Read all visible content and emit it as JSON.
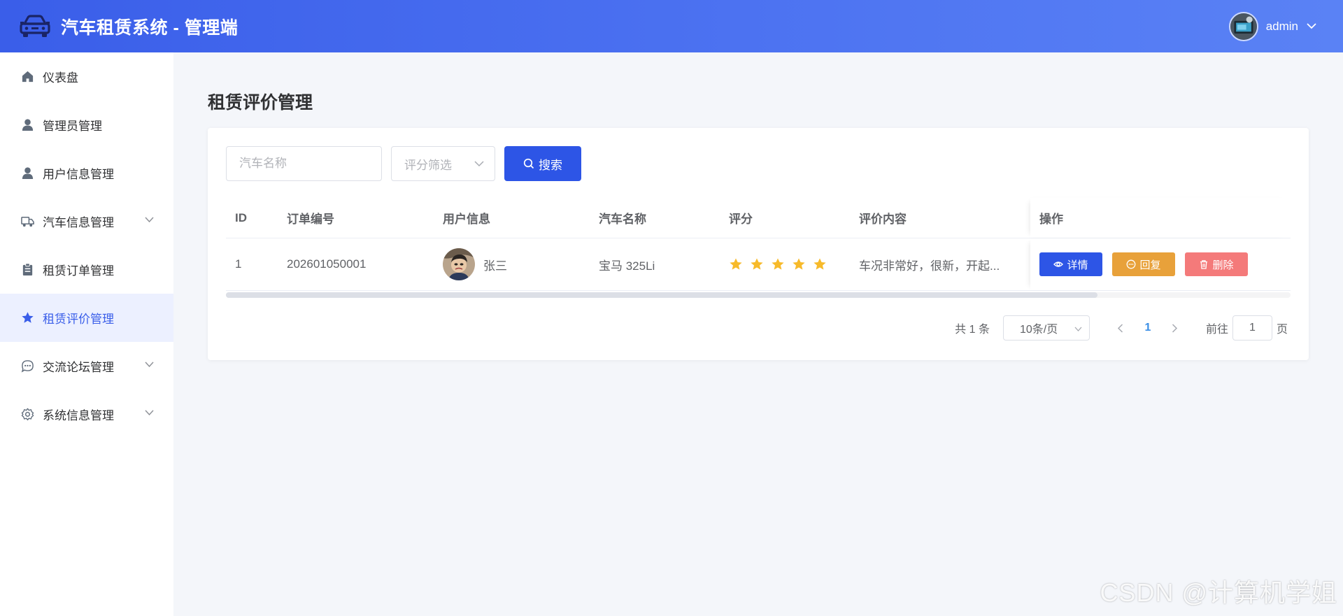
{
  "header": {
    "app_title": "汽车租赁系统 - 管理端",
    "user_name": "admin"
  },
  "sidebar": {
    "items": [
      {
        "label": "仪表盘",
        "icon": "home-icon"
      },
      {
        "label": "管理员管理",
        "icon": "user-icon"
      },
      {
        "label": "用户信息管理",
        "icon": "user-icon"
      },
      {
        "label": "汽车信息管理",
        "icon": "truck-icon"
      },
      {
        "label": "租赁订单管理",
        "icon": "clipboard-icon"
      },
      {
        "label": "租赁评价管理",
        "icon": "star-icon",
        "active": true
      },
      {
        "label": "交流论坛管理",
        "icon": "chat-icon"
      },
      {
        "label": "系统信息管理",
        "icon": "gear-icon"
      }
    ]
  },
  "page": {
    "title": "租赁评价管理"
  },
  "filters": {
    "car_name_placeholder": "汽车名称",
    "rating_placeholder": "评分筛选",
    "search_label": "搜索"
  },
  "table": {
    "headers": {
      "id": "ID",
      "order_no": "订单编号",
      "user_info": "用户信息",
      "car_name": "汽车名称",
      "rating": "评分",
      "content": "评价内容",
      "actions": "操作"
    },
    "rows": [
      {
        "id": "1",
        "order_no": "202601050001",
        "user_name": "张三",
        "car_name": "宝马 325Li",
        "rating": 5,
        "content": "车况非常好，很新，开起..."
      }
    ],
    "actions": {
      "detail": "详情",
      "reply": "回复",
      "delete": "删除"
    }
  },
  "pagination": {
    "total_text": "共 1 条",
    "page_size": "10条/页",
    "current_page": "1",
    "goto_label": "前往",
    "goto_value": "1",
    "page_suffix": "页"
  },
  "watermark": "CSDN @计算机学姐",
  "colors": {
    "primary": "#2d55e6",
    "reply": "#e8a13a",
    "delete": "#f47a7a",
    "star": "#f7ba2a",
    "header_gradient_start": "#3a5ee9",
    "header_gradient_end": "#5a82f5"
  }
}
